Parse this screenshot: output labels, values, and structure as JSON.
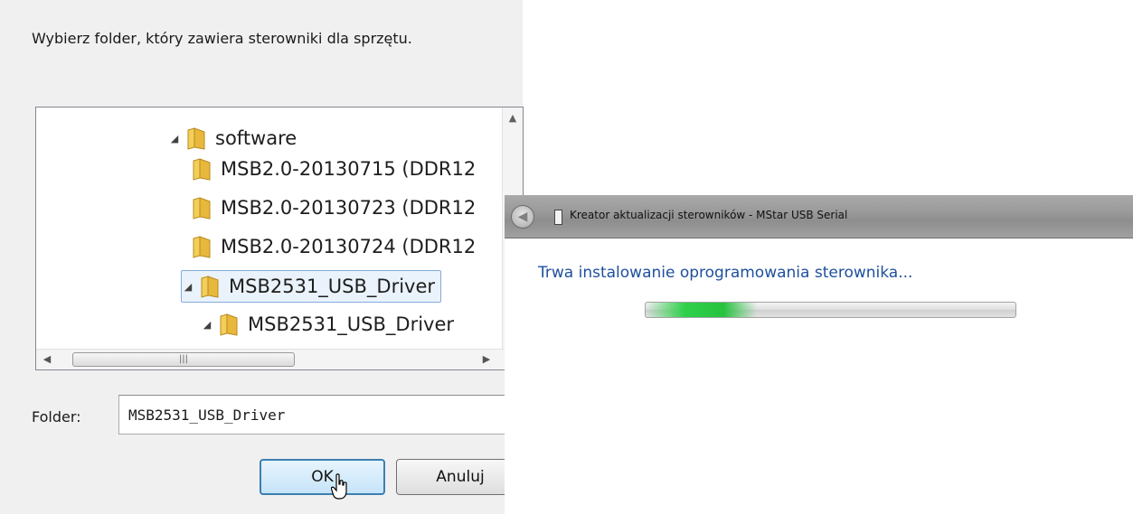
{
  "browse_dialog": {
    "instruction": "Wybierz folder, który zawiera sterowniki dla sprzętu.",
    "tree": [
      {
        "label": "software",
        "expanded": true,
        "selected": false
      },
      {
        "label": "MSB2.0-20130715 (DDR12",
        "expanded": false,
        "selected": false
      },
      {
        "label": "MSB2.0-20130723 (DDR12",
        "expanded": false,
        "selected": false
      },
      {
        "label": "MSB2.0-20130724 (DDR12",
        "expanded": false,
        "selected": false
      },
      {
        "label": "MSB2531_USB_Driver",
        "expanded": true,
        "selected": true
      },
      {
        "label": "MSB2531_USB_Driver",
        "expanded": true,
        "selected": false
      }
    ],
    "folder_label": "Folder:",
    "folder_value": "MSB2531_USB_Driver",
    "ok_label": "OK",
    "cancel_label": "Anuluj"
  },
  "wizard": {
    "title": "Kreator aktualizacji sterowników - MStar USB Serial",
    "heading": "Trwa instalowanie oprogramowania sterownika...",
    "progress": 0.3
  },
  "colors": {
    "heading_blue": "#1e4f9c",
    "progress_green": "#2fd14a",
    "selection_border": "#84acdd",
    "folder_yellow": "#e8b83c"
  }
}
